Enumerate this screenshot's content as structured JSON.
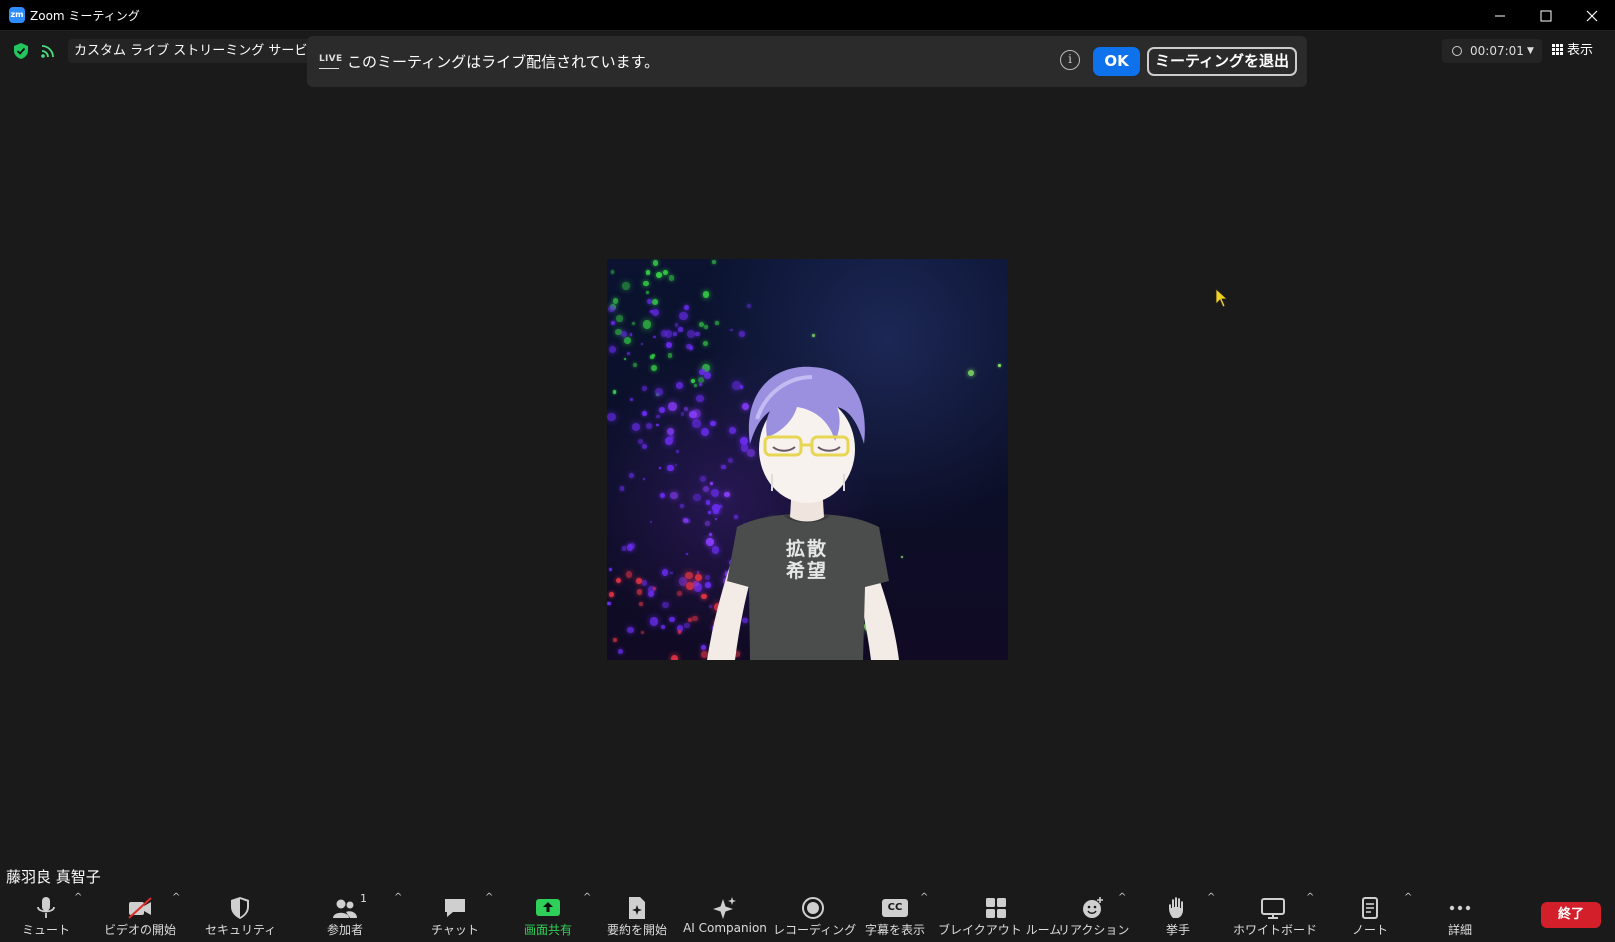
{
  "window": {
    "title": "Zoom ミーティング",
    "app_icon": "zm",
    "controls": [
      "minimize-icon",
      "maximize-icon",
      "close-icon"
    ]
  },
  "top_left": {
    "security_icon": "shield-check-icon",
    "feed_icon": "live-feed-icon",
    "stream_service": "カスタム ライブ ストリーミング サービス"
  },
  "banner": {
    "live_badge": "LIVE",
    "message": "このミーティングはライブ配信されています。",
    "ok_label": "OK",
    "leave_label": "ミーティングを退出"
  },
  "top_right": {
    "timer": "00:07:01",
    "view_label": "表示"
  },
  "participant": {
    "name": "藤羽良 真智子",
    "shirt_text": "拡散希望"
  },
  "toolbar": {
    "mute": "ミュート",
    "video": "ビデオの開始",
    "security": "セキュリティ",
    "participants": "参加者",
    "participants_count": "1",
    "chat": "チャット",
    "share": "画面共有",
    "summary": "要約を開始",
    "ai_companion": "AI Companion",
    "recording": "レコーディング",
    "captions": "字幕を表示",
    "captions_badge": "CC",
    "breakout": "ブレイクアウト ルーム",
    "reactions": "リアクション",
    "raise_hand": "挙手",
    "whiteboard": "ホワイトボード",
    "notes": "ノート",
    "more": "詳細",
    "end": "終了"
  },
  "colors": {
    "share_green": "#2fd05a",
    "ok_blue": "#0e72ed",
    "end_red": "#d31f2a",
    "shield_green": "#22c55e"
  }
}
